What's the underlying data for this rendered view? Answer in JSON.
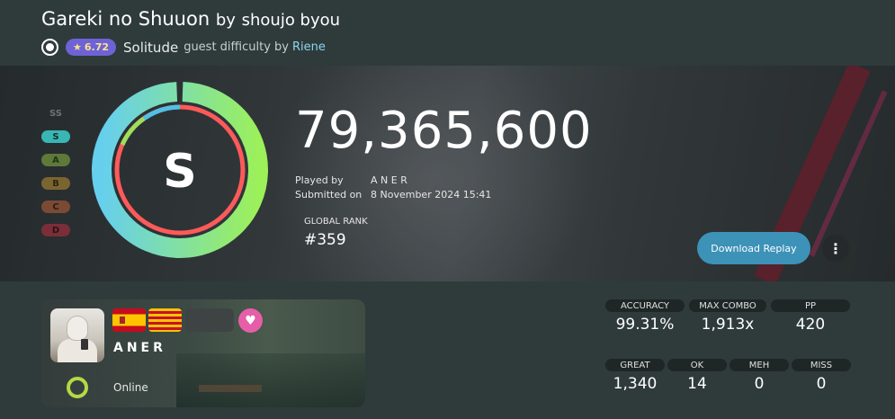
{
  "beatmap": {
    "title": "Gareki no Shuuon",
    "by_label": "by",
    "artist": "shoujo byou",
    "star_rating": "6.72",
    "version": "Solitude",
    "guest_label": "guest difficulty by",
    "mapper": "Riene"
  },
  "grades": [
    "SS",
    "S",
    "A",
    "B",
    "C",
    "D"
  ],
  "result": {
    "rank": "S",
    "score": "79,365,600",
    "played_by_label": "Played by",
    "played_by": "A N E R",
    "submitted_label": "Submitted on",
    "submitted_on": "8 November 2024 15:41",
    "global_rank_label": "GLOBAL RANK",
    "global_rank": "#359"
  },
  "actions": {
    "download_replay": "Download Replay",
    "more_icon": "more-vertical-icon"
  },
  "player": {
    "name": "ANER",
    "status": "Online",
    "flags": [
      "spain-flag",
      "catalonia-flag"
    ],
    "heart_icon": "heart-icon"
  },
  "stats": {
    "accuracy": {
      "label": "ACCURACY",
      "value": "99.31%"
    },
    "max_combo": {
      "label": "MAX COMBO",
      "value": "1,913x"
    },
    "pp": {
      "label": "PP",
      "value": "420"
    },
    "great": {
      "label": "GREAT",
      "value": "1,340"
    },
    "ok": {
      "label": "OK",
      "value": "14"
    },
    "meh": {
      "label": "MEH",
      "value": "0"
    },
    "miss": {
      "label": "MISS",
      "value": "0"
    }
  },
  "colors": {
    "accent": "#3d92b8",
    "star_badge": "#6d63d6",
    "heart": "#e65ea8",
    "online": "#b3d944"
  }
}
